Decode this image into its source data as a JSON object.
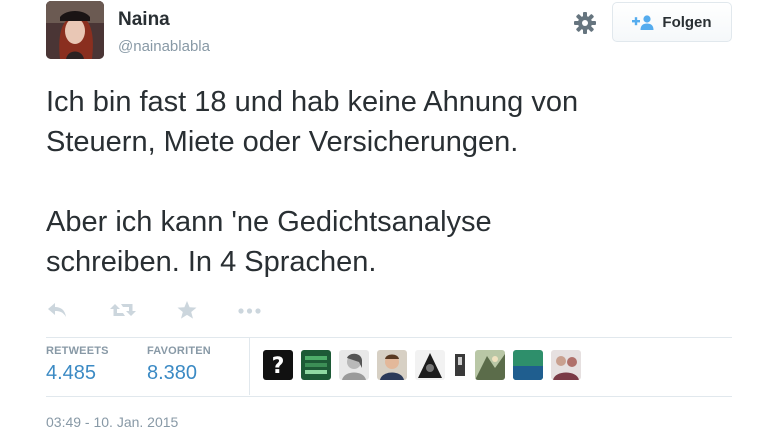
{
  "author": {
    "name": "Naina",
    "handle": "@nainablabla"
  },
  "follow_button": {
    "label": "Folgen",
    "icon": "follow-user-icon"
  },
  "settings_icon": "gear-icon",
  "tweet": {
    "paragraphs": [
      "Ich bin fast 18 und hab keine Ahnung von\nSteuern, Miete oder Versicherungen.",
      "Aber ich kann 'ne Gedichtsanalyse\nschreiben. In 4 Sprachen."
    ]
  },
  "actions": [
    "reply-icon",
    "retweet-icon",
    "favorite-star-icon",
    "more-icon"
  ],
  "stats": {
    "retweets": {
      "label": "RETWEETS",
      "value": "4.485"
    },
    "favorites": {
      "label": "FAVORITEN",
      "value": "8.380"
    }
  },
  "favoriters": [
    "avatar-question-mark",
    "avatar-green",
    "avatar-woman-sketch",
    "avatar-man",
    "avatar-dark-hood",
    "avatar-small-figure",
    "avatar-art",
    "avatar-teal",
    "avatar-group"
  ],
  "timestamp": "03:49 - 10. Jan. 2015",
  "colors": {
    "text": "#292f33",
    "muted": "#8899a6",
    "link": "#3b8ac4",
    "border": "#e1e8ed",
    "follow_icon": "#55acee"
  }
}
